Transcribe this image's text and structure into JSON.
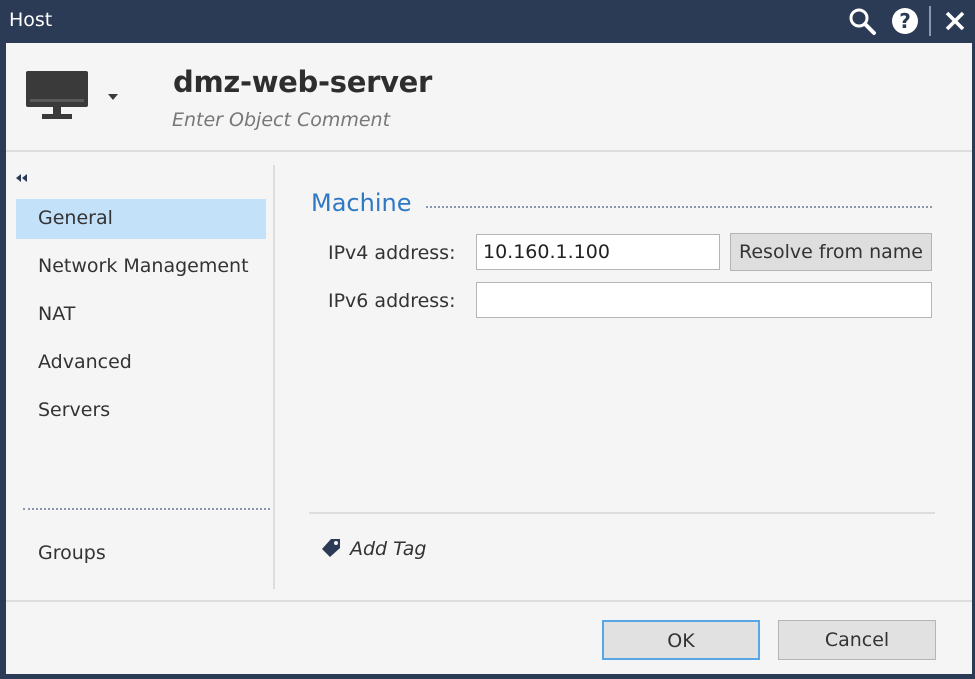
{
  "window": {
    "title": "Host",
    "icons": [
      "search-icon",
      "help-icon",
      "close-icon"
    ]
  },
  "header": {
    "object_icon": "monitor-icon",
    "object_name": "dmz-web-server",
    "comment_placeholder": "Enter Object Comment"
  },
  "sidebar": {
    "collapse_icon": "double-chevron-left-icon",
    "items": [
      {
        "label": "General",
        "active": true
      },
      {
        "label": "Network Management",
        "active": false
      },
      {
        "label": "NAT",
        "active": false
      },
      {
        "label": "Advanced",
        "active": false
      },
      {
        "label": "Servers",
        "active": false
      }
    ],
    "bottom_items": [
      {
        "label": "Groups"
      }
    ]
  },
  "main": {
    "section_title": "Machine",
    "ipv4": {
      "label": "IPv4 address:",
      "value": "10.160.1.100"
    },
    "ipv6": {
      "label": "IPv6 address:",
      "value": ""
    },
    "resolve_label": "Resolve from name",
    "add_tag_label": "Add Tag",
    "tag_icon": "tag-icon"
  },
  "footer": {
    "ok_label": "OK",
    "cancel_label": "Cancel"
  },
  "colors": {
    "titlebar": "#2b3a55",
    "accent": "#2f78c4",
    "active_nav": "#c4e1fa",
    "focus_border": "#58a6e6"
  }
}
